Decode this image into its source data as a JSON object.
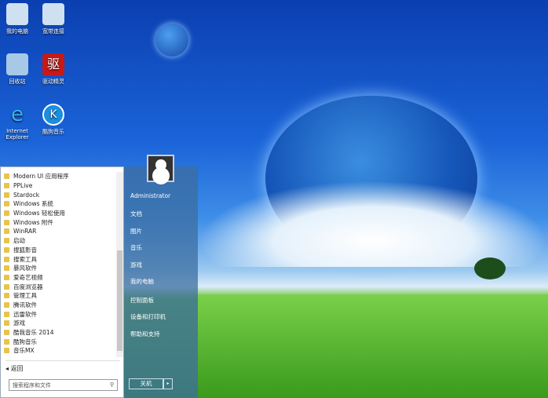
{
  "desktop": {
    "icons": [
      {
        "label": "我的电脑"
      },
      {
        "label": "宽带连接"
      },
      {
        "label": "回收站"
      },
      {
        "label": "驱动精灵"
      },
      {
        "label": "Internet Explorer"
      },
      {
        "label": "酷狗音乐"
      }
    ]
  },
  "start_menu": {
    "programs": [
      "Modern UI 应用程序",
      "PPLive",
      "Stardock",
      "Windows 系统",
      "Windows 轻松使用",
      "Windows 附件",
      "WinRAR",
      "启动",
      "搜狐影音",
      "搜索工具",
      "暴风软件",
      "爱奇艺视频",
      "百度浏览器",
      "管理工具",
      "腾讯软件",
      "迅雷软件",
      "游戏",
      "酷我音乐 2014",
      "酷狗音乐",
      "音乐MX"
    ],
    "back_label": "返回",
    "search_placeholder": "搜索程序和文件",
    "user": "Administrator",
    "right_items": [
      "文档",
      "图片",
      "音乐",
      "游戏",
      "我的电脑",
      "控制面板",
      "设备和打印机",
      "帮助和支持"
    ],
    "shutdown_label": "关机"
  }
}
